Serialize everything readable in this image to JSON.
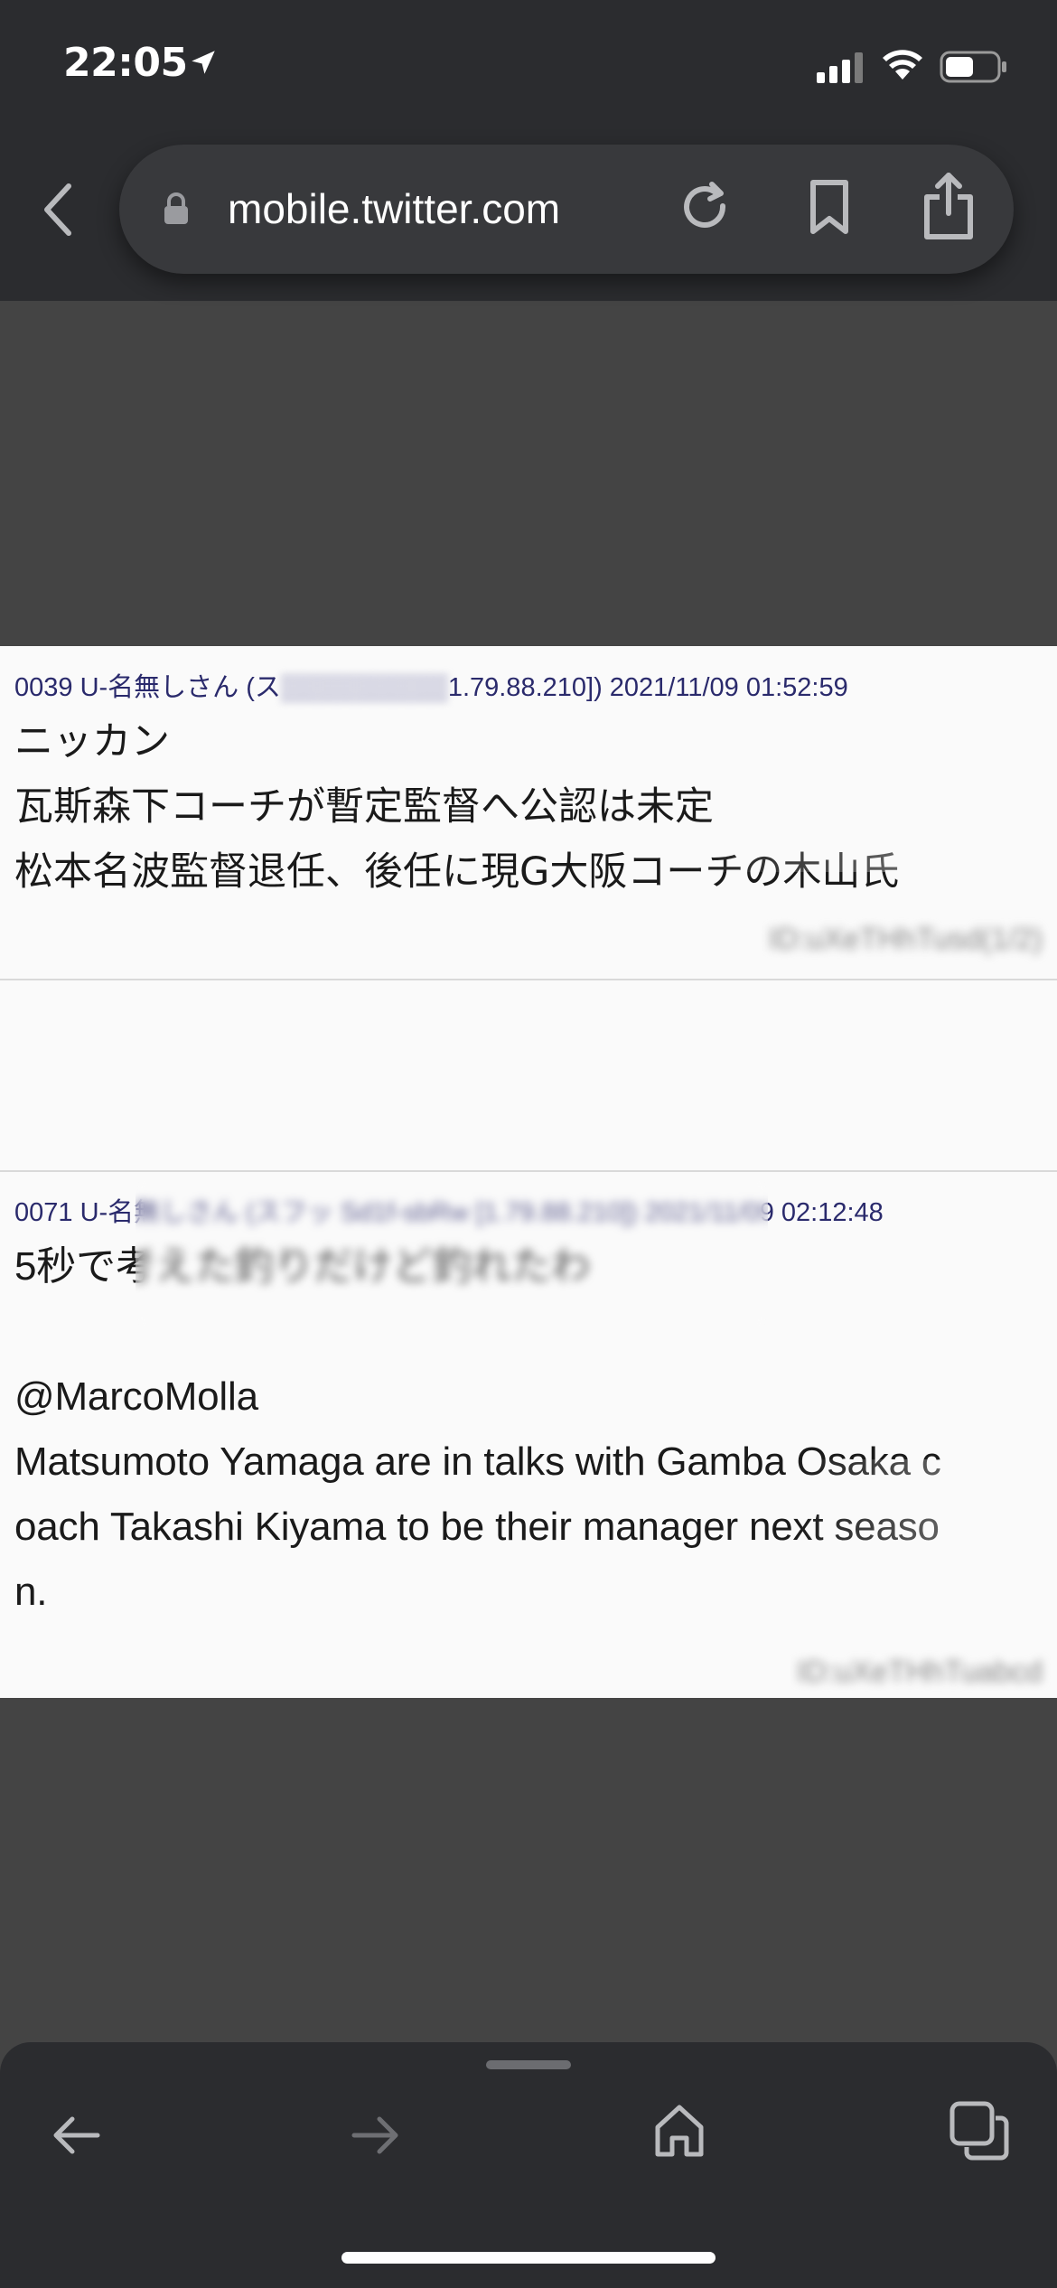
{
  "status_bar": {
    "time": "22:05",
    "icons": [
      "location-arrow-icon",
      "cellular-signal-icon",
      "wifi-icon",
      "battery-icon"
    ],
    "battery_level": 0.5
  },
  "browser": {
    "url": "mobile.twitter.com",
    "icons": [
      "chevron-left-icon",
      "lock-icon",
      "reload-icon",
      "bookmark-icon",
      "share-icon"
    ]
  },
  "posts": [
    {
      "header_visible": "0039 U-名無しさん (ス",
      "header_tail": "1.79.88.210]) 2021/11/09 01:52:59",
      "body": "ニッカン\n瓦斯森下コーチが暫定監督へ公認は未定\n松本名波監督退任、後任に現G大阪コーチの木山氏",
      "id_text": "ID:uXeTHhTusd(1/2)"
    },
    {
      "header_visible": "0071 U-名無しさん (スフッ Sd1f-sbRw",
      "header_tail": "[1.79.88.210]) 2021/11/09 02:12:48",
      "body": "5秒で考えた釣りだけど釣れたわ\n\n@MarcoMolla\nMatsumoto Yamaga are in talks with Gamba Osaka c\noach Takashi Kiyama to be their manager next seaso\nn.",
      "id_text": "ID:uXeTHhTuabcd"
    }
  ],
  "bottom_bar": {
    "icons": [
      "arrow-left-icon",
      "arrow-right-icon",
      "home-icon",
      "tabs-icon"
    ]
  },
  "colors": {
    "chrome_bg": "#2b2c2f",
    "page_bg": "#444444",
    "content_bg": "#fafafa",
    "header_text": "#2a2a6c"
  }
}
